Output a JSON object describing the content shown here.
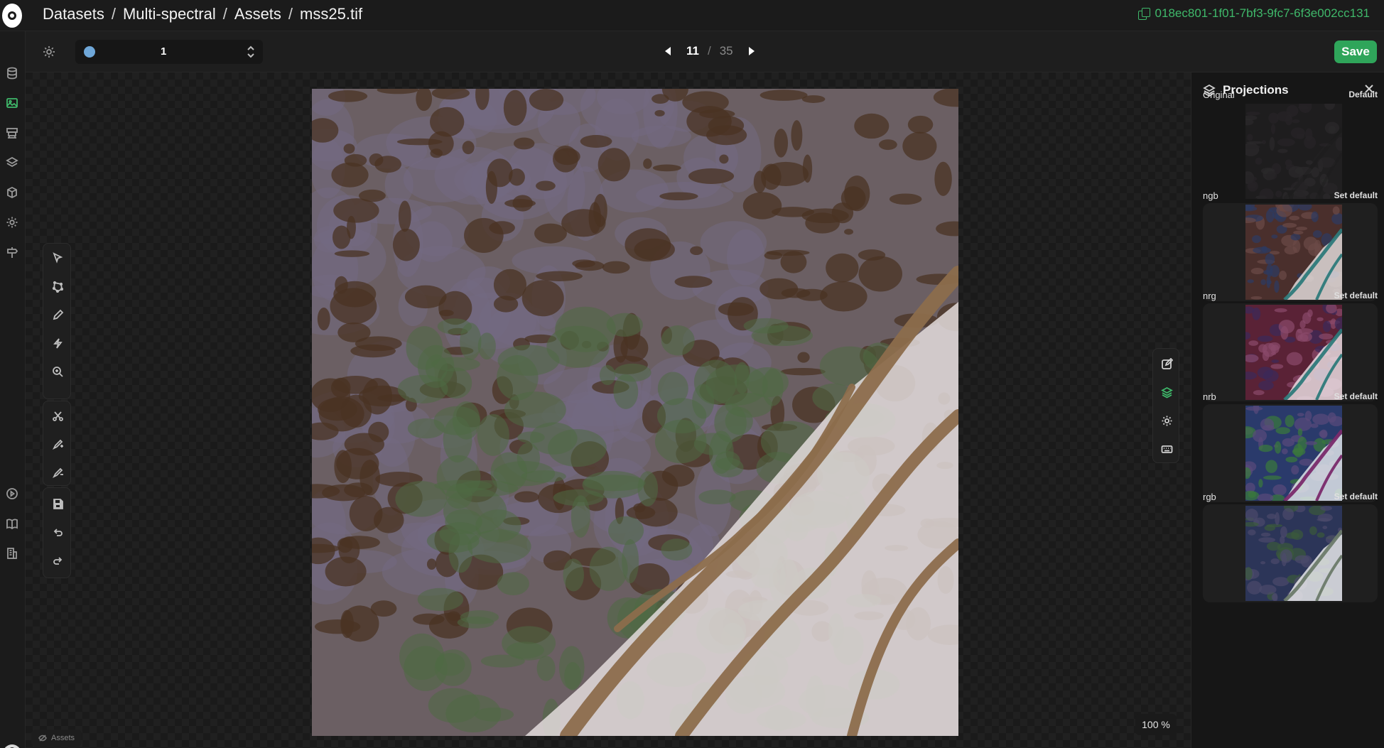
{
  "breadcrumb": [
    "Datasets",
    "Multi-spectral",
    "Assets",
    "mss25.tif"
  ],
  "asset_id": "018ec801-1f01-7bf3-9fc7-6f3e002cc131",
  "toolbar": {
    "class_value": "1",
    "class_color": "#6fa7d8",
    "page_current": "11",
    "page_total": "35",
    "save_label": "Save"
  },
  "projections": {
    "title": "Projections",
    "items": [
      {
        "name": "Original",
        "action": "Default",
        "palette": [
          "#1e1d1e",
          "#262426",
          "#2b2a2b",
          "#1a191a",
          "#313030"
        ]
      },
      {
        "name": "ngb",
        "action": "Set default",
        "palette": [
          "#4a2f2c",
          "#2c3b63",
          "#6b4a47",
          "#2e7a7a",
          "#e8e3e3"
        ]
      },
      {
        "name": "nrg",
        "action": "Set default",
        "palette": [
          "#5a2236",
          "#3b2a5a",
          "#8a4a6b",
          "#2e7a7a",
          "#f0e6ea"
        ]
      },
      {
        "name": "nrb",
        "action": "Set default",
        "palette": [
          "#2a3a6b",
          "#3a7a3a",
          "#5a4a7a",
          "#7a2a6b",
          "#e8eef0"
        ]
      },
      {
        "name": "rgb",
        "action": "Set default",
        "palette": [
          "#2c3558",
          "#3b5a3b",
          "#4c4a6b",
          "#6b7a6a",
          "#f2f2f2"
        ]
      }
    ]
  },
  "zoom_label": "100 %",
  "status_label": "Assets",
  "image_palette": {
    "base": "#6b5f63",
    "purple": "#736a82",
    "dark": "#4a3323",
    "green": "#4f6a44",
    "river": "#8c6d4c",
    "sand": "#e3dcdc"
  }
}
